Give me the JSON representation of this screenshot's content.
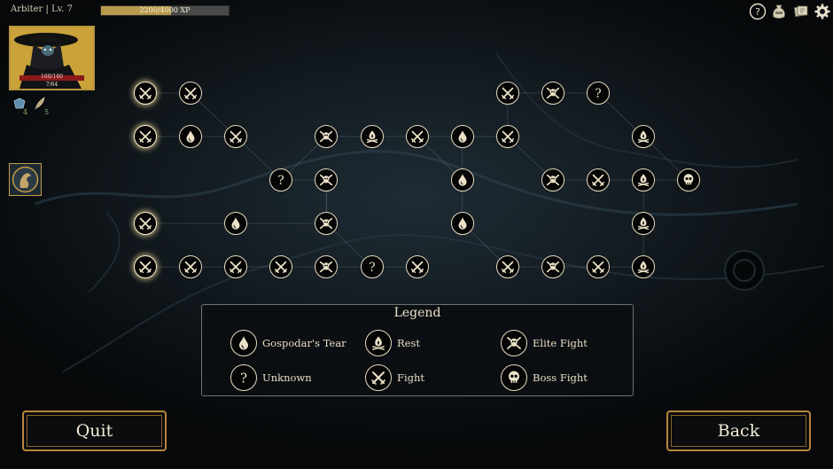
{
  "player": {
    "class_label": "Arbiter",
    "level_label": "Lv. 7"
  },
  "xp": {
    "text": "2200/4000 XP",
    "fraction": 0.55
  },
  "portrait": {
    "hp_text": "160/160",
    "hp_fraction": 1.0,
    "sub_text": "7/64"
  },
  "resources": [
    {
      "icon": "crystal-icon",
      "count": "4"
    },
    {
      "icon": "feather-icon",
      "count": "5"
    }
  ],
  "top_icons": [
    "help-icon",
    "loot-bag-icon",
    "card-deck-icon",
    "settings-icon"
  ],
  "legend": {
    "title": "Legend",
    "items": [
      {
        "type": "tear",
        "label": "Gospodar's Tear"
      },
      {
        "type": "rest",
        "label": "Rest"
      },
      {
        "type": "elite",
        "label": "Elite Fight"
      },
      {
        "type": "unknown",
        "label": "Unknown"
      },
      {
        "type": "fight",
        "label": "Fight"
      },
      {
        "type": "boss",
        "label": "Boss Fight"
      }
    ]
  },
  "buttons": {
    "quit": "Quit",
    "back": "Back"
  },
  "colors": {
    "accent_gold": "#b8853e",
    "xp_fill": "#b79a4e",
    "hp_fill": "#8b1a1a",
    "node_border": "#e7dcc2"
  },
  "map": {
    "columns": 13,
    "rows": 5,
    "nodes": [
      {
        "id": "n0",
        "col": 0,
        "row": 0,
        "type": "fight",
        "selectable": true
      },
      {
        "id": "n1",
        "col": 1,
        "row": 0,
        "type": "fight"
      },
      {
        "id": "n2",
        "col": 8,
        "row": 0,
        "type": "fight"
      },
      {
        "id": "n3",
        "col": 9,
        "row": 0,
        "type": "elite"
      },
      {
        "id": "n4",
        "col": 10,
        "row": 0,
        "type": "unknown"
      },
      {
        "id": "n5",
        "col": 0,
        "row": 1,
        "type": "fight",
        "selectable": true
      },
      {
        "id": "n6",
        "col": 1,
        "row": 1,
        "type": "tear"
      },
      {
        "id": "n7",
        "col": 2,
        "row": 1,
        "type": "fight"
      },
      {
        "id": "n8",
        "col": 4,
        "row": 1,
        "type": "elite"
      },
      {
        "id": "n9",
        "col": 5,
        "row": 1,
        "type": "rest"
      },
      {
        "id": "n10",
        "col": 6,
        "row": 1,
        "type": "fight"
      },
      {
        "id": "n11",
        "col": 7,
        "row": 1,
        "type": "tear"
      },
      {
        "id": "n12",
        "col": 8,
        "row": 1,
        "type": "fight"
      },
      {
        "id": "n13",
        "col": 11,
        "row": 1,
        "type": "rest"
      },
      {
        "id": "n14",
        "col": 3,
        "row": 2,
        "type": "unknown"
      },
      {
        "id": "n15",
        "col": 4,
        "row": 2,
        "type": "elite"
      },
      {
        "id": "n16",
        "col": 7,
        "row": 2,
        "type": "tear"
      },
      {
        "id": "n17",
        "col": 9,
        "row": 2,
        "type": "elite"
      },
      {
        "id": "n18",
        "col": 10,
        "row": 2,
        "type": "fight"
      },
      {
        "id": "n19",
        "col": 11,
        "row": 2,
        "type": "rest"
      },
      {
        "id": "n20",
        "col": 12,
        "row": 2,
        "type": "boss"
      },
      {
        "id": "n21",
        "col": 0,
        "row": 3,
        "type": "fight",
        "selectable": true
      },
      {
        "id": "n22",
        "col": 2,
        "row": 3,
        "type": "tear"
      },
      {
        "id": "n23",
        "col": 4,
        "row": 3,
        "type": "elite"
      },
      {
        "id": "n24",
        "col": 7,
        "row": 3,
        "type": "tear"
      },
      {
        "id": "n25",
        "col": 11,
        "row": 3,
        "type": "rest"
      },
      {
        "id": "n26",
        "col": 0,
        "row": 4,
        "type": "fight",
        "selectable": true
      },
      {
        "id": "n27",
        "col": 1,
        "row": 4,
        "type": "fight"
      },
      {
        "id": "n28",
        "col": 2,
        "row": 4,
        "type": "fight"
      },
      {
        "id": "n29",
        "col": 3,
        "row": 4,
        "type": "fight"
      },
      {
        "id": "n30",
        "col": 4,
        "row": 4,
        "type": "elite"
      },
      {
        "id": "n31",
        "col": 5,
        "row": 4,
        "type": "unknown"
      },
      {
        "id": "n32",
        "col": 6,
        "row": 4,
        "type": "fight"
      },
      {
        "id": "n33",
        "col": 8,
        "row": 4,
        "type": "fight"
      },
      {
        "id": "n34",
        "col": 9,
        "row": 4,
        "type": "elite"
      },
      {
        "id": "n35",
        "col": 10,
        "row": 4,
        "type": "fight"
      },
      {
        "id": "n36",
        "col": 11,
        "row": 4,
        "type": "rest"
      }
    ],
    "edges": [
      [
        "n0",
        "n1"
      ],
      [
        "n1",
        "n7"
      ],
      [
        "n5",
        "n6"
      ],
      [
        "n6",
        "n7"
      ],
      [
        "n7",
        "n14"
      ],
      [
        "n14",
        "n8"
      ],
      [
        "n14",
        "n15"
      ],
      [
        "n8",
        "n9"
      ],
      [
        "n9",
        "n10"
      ],
      [
        "n10",
        "n11"
      ],
      [
        "n11",
        "n12"
      ],
      [
        "n12",
        "n2"
      ],
      [
        "n2",
        "n3"
      ],
      [
        "n3",
        "n4"
      ],
      [
        "n4",
        "n13"
      ],
      [
        "n12",
        "n17"
      ],
      [
        "n13",
        "n20"
      ],
      [
        "n17",
        "n18"
      ],
      [
        "n18",
        "n19"
      ],
      [
        "n19",
        "n20"
      ],
      [
        "n21",
        "n22"
      ],
      [
        "n22",
        "n23"
      ],
      [
        "n23",
        "n15"
      ],
      [
        "n23",
        "n31"
      ],
      [
        "n11",
        "n16"
      ],
      [
        "n16",
        "n24"
      ],
      [
        "n24",
        "n33"
      ],
      [
        "n26",
        "n27"
      ],
      [
        "n27",
        "n28"
      ],
      [
        "n28",
        "n29"
      ],
      [
        "n29",
        "n30"
      ],
      [
        "n30",
        "n31"
      ],
      [
        "n31",
        "n32"
      ],
      [
        "n33",
        "n34"
      ],
      [
        "n34",
        "n35"
      ],
      [
        "n35",
        "n36"
      ],
      [
        "n36",
        "n25"
      ],
      [
        "n25",
        "n19"
      ],
      [
        "n15",
        "n23"
      ],
      [
        "n10",
        "n16"
      ]
    ]
  }
}
